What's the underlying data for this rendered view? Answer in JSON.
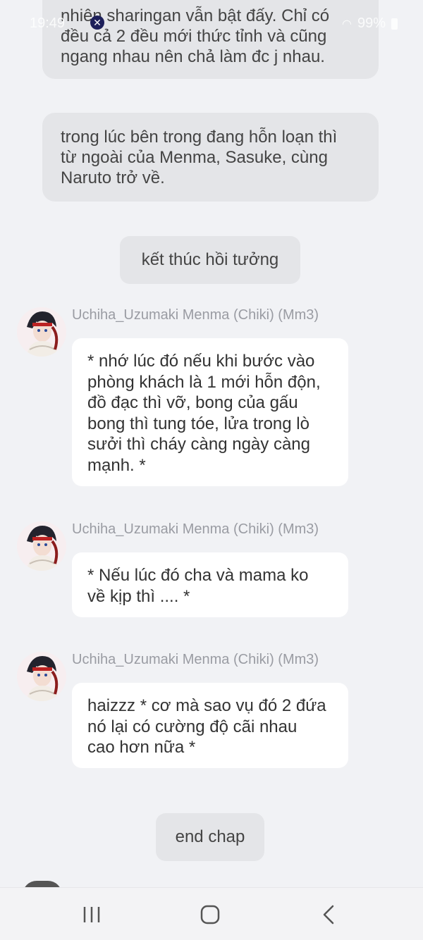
{
  "status_bar": {
    "time": "19:49",
    "battery": "99%"
  },
  "narration_top": {
    "lines": [
      "nhiên sharingan vẫn bật đấy. Chỉ có",
      "đều cả 2 đều mới thức tỉnh và cũng",
      "ngang nhau nên chả làm đc j nhau."
    ]
  },
  "narration_2": {
    "lines": [
      "trong lúc bên trong đang hỗn loạn thì",
      "từ ngoài của Menma, Sasuke, cùng",
      "Naruto trở về."
    ]
  },
  "pill_flashback": "kết thúc hồi tưởng",
  "messages": [
    {
      "sender": "Uchiha_Uzumaki Menma (Chiki) (Mm3)",
      "lines": [
        "* nhớ lúc đó nếu khi bước vào",
        "phòng khách là 1 mới hỗn độn,",
        "đồ đạc thì vỡ, bong của gấu",
        "bong thì tung tóe, lửa trong lò",
        "sưởi thì cháy càng ngày càng",
        "mạnh. *"
      ]
    },
    {
      "sender": "Uchiha_Uzumaki Menma (Chiki) (Mm3)",
      "lines": [
        "* Nếu lúc đó cha và mama ko",
        "về kịp thì .... *"
      ]
    },
    {
      "sender": "Uchiha_Uzumaki Menma (Chiki) (Mm3)",
      "lines": [
        "haizzz * cơ mà sao vụ đó 2 đứa",
        "nó lại có cường độ cãi nhau",
        "cao hơn nữa *"
      ]
    }
  ],
  "pill_endchap": "end chap",
  "nav": {
    "recent_icon": "recent-apps-icon",
    "home_icon": "home-icon",
    "back_icon": "back-icon"
  }
}
